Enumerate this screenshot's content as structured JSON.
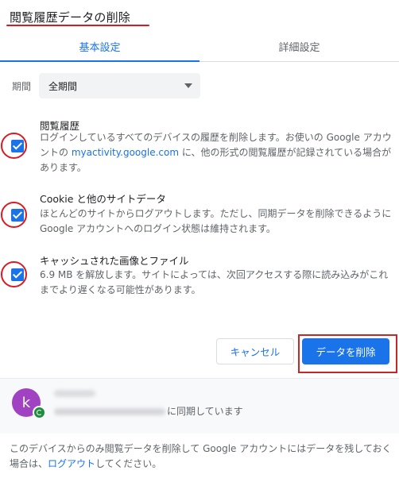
{
  "dialog": {
    "title": "閲覧履歴データの削除"
  },
  "tabs": [
    {
      "label": "基本設定",
      "active": true
    },
    {
      "label": "詳細設定",
      "active": false
    }
  ],
  "period": {
    "label": "期間",
    "selected": "全期間"
  },
  "options": [
    {
      "title": "閲覧履歴",
      "desc_before": "ログインしているすべてのデバイスの履歴を削除します。お使いの Google アカウントの ",
      "desc_link": "myactivity.google.com",
      "desc_after": " に、他の形式の閲覧履歴が記録されている場合があります。",
      "checked": true
    },
    {
      "title": "Cookie と他のサイトデータ",
      "desc": "ほとんどのサイトからログアウトします。ただし、同期データを削除できるように Google アカウントへのログイン状態は維持されます。",
      "checked": true
    },
    {
      "title": "キャッシュされた画像とファイル",
      "desc": "6.9 MB を解放します。サイトによっては、次回アクセスする際に読み込みがこれまでより遅くなる可能性があります。",
      "checked": true
    }
  ],
  "buttons": {
    "cancel": "キャンセル",
    "delete": "データを削除"
  },
  "account": {
    "avatar_letter": "k",
    "sync_text": "に同期しています"
  },
  "footer": {
    "text_before": "このデバイスからのみ閲覧データを削除して Google アカウントにはデータを残しておく場合は、",
    "link": "ログアウト",
    "text_after": "してください。"
  },
  "colors": {
    "accent": "#1a73e8",
    "annotation_red": "#d81b23",
    "avatar": "#a142c2",
    "sync_green": "#1e8e3e"
  }
}
